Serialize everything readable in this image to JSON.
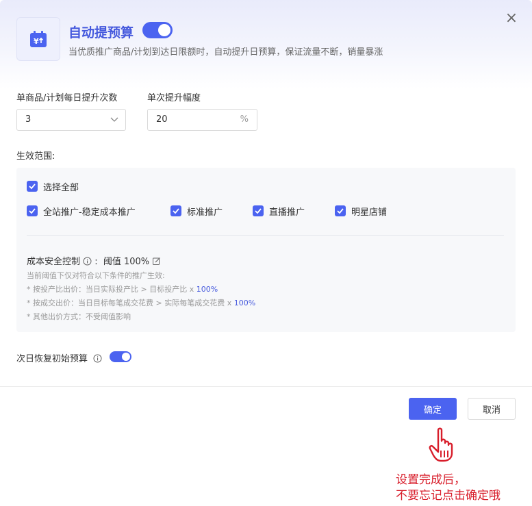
{
  "header": {
    "title": "自动提预算",
    "subtitle": "当优质推广商品/计划到达日限额时，自动提升日预算，保证流量不断，销量暴涨",
    "icon": "calendar-yen-up-icon",
    "enabled": true
  },
  "fields": {
    "daily_times_label": "单商品/计划每日提升次数",
    "daily_times_value": "3",
    "increase_label": "单次提升幅度",
    "increase_value": "20",
    "increase_unit": "%"
  },
  "scope": {
    "label": "生效范围:",
    "select_all": "选择全部",
    "options": [
      "全站推广-稳定成本推广",
      "标准推广",
      "直播推广",
      "明星店铺"
    ],
    "cost_control_label": "成本安全控制",
    "cost_control_value": "阈值 100%",
    "hint_title": "当前阈值下仅对符合以下条件的推广生效:",
    "hint_1": "* 按投产比出价：当日实际投产比 > 目标投产比 x ",
    "hint_1_pct": "100%",
    "hint_2": "* 按成交出价：当日目标每笔成交花费 > 实际每笔成交花费 x ",
    "hint_2_pct": "100%",
    "hint_3": "* 其他出价方式：不受阈值影响"
  },
  "reset": {
    "label": "次日恢复初始预算",
    "enabled": true
  },
  "footer": {
    "ok": "确定",
    "cancel": "取消"
  },
  "annotation": {
    "line1": "设置完成后，",
    "line2": "不要忘记点击确定哦"
  },
  "colors": {
    "accent": "#4b63f0",
    "title": "#4559dd",
    "note": "#d81e2b"
  }
}
